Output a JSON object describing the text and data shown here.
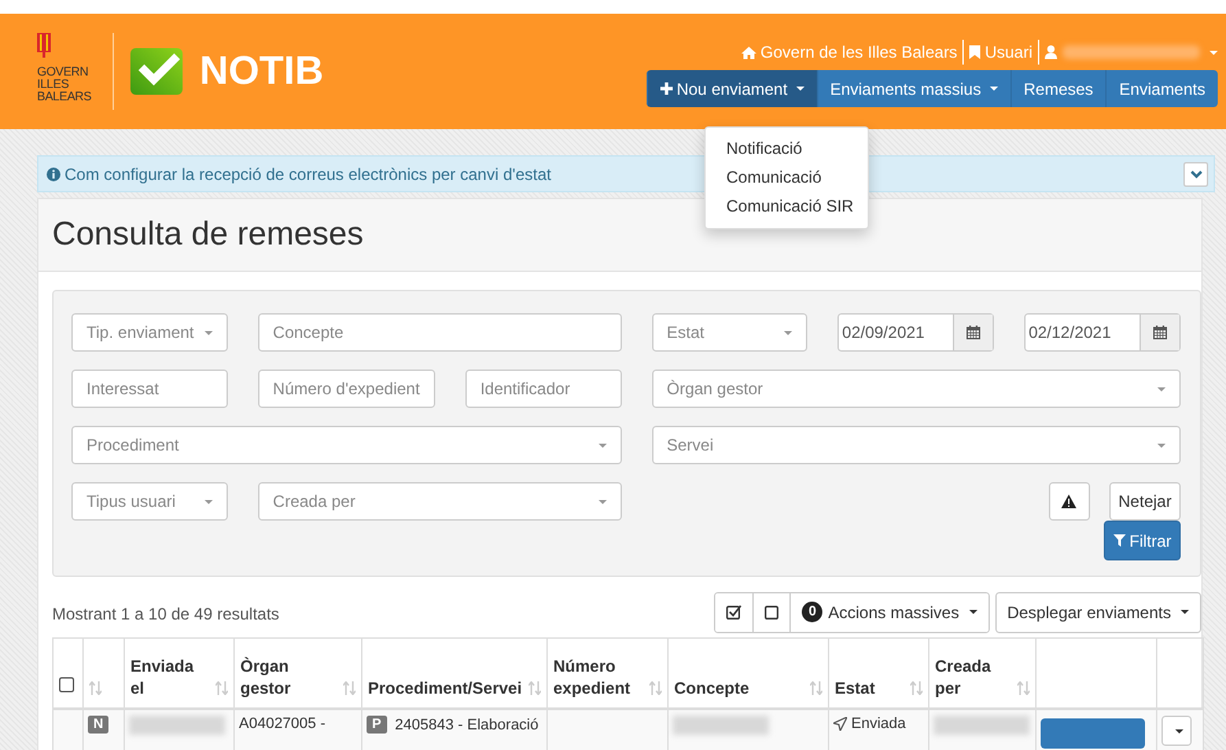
{
  "header": {
    "org_lines": [
      "GOVERN",
      "ILLES",
      "BALEARS"
    ],
    "app_name": "NOTIB",
    "top_links": [
      {
        "kind": "home",
        "label": "Govern de les Illes Balears"
      },
      {
        "kind": "bookmark",
        "label": "Usuari"
      },
      {
        "kind": "user"
      }
    ],
    "nav": [
      {
        "kind": "add-menu",
        "label": "Nou enviament",
        "selected": true
      },
      {
        "kind": "menu",
        "label": "Enviaments massius",
        "selected": false
      },
      {
        "kind": "link",
        "label": "Remeses",
        "selected": false
      },
      {
        "kind": "link",
        "label": "Enviaments",
        "selected": false
      }
    ]
  },
  "dropdown_menu": {
    "items": [
      "Notificació",
      "Comunicació",
      "Comunicació SIR"
    ]
  },
  "info_bar": {
    "text": "Com configurar la recepció de correus electrònics per canvi d'estat"
  },
  "page_title": "Consulta de remeses",
  "filters": [
    {
      "kind": "select",
      "placeholder": "Tip. enviament"
    },
    {
      "kind": "text",
      "placeholder": "Concepte"
    },
    {
      "kind": "select",
      "placeholder": "Estat"
    },
    {
      "kind": "date",
      "value": "02/09/2021"
    },
    {
      "kind": "date",
      "value": "02/12/2021"
    },
    {
      "kind": "text",
      "placeholder": "Interessat"
    },
    {
      "kind": "text",
      "placeholder": "Número d'expedient"
    },
    {
      "kind": "text",
      "placeholder": "Identificador"
    },
    {
      "kind": "select",
      "placeholder": "Òrgan gestor"
    },
    {
      "kind": "select",
      "placeholder": "Procediment"
    },
    {
      "kind": "select",
      "placeholder": "Servei"
    },
    {
      "kind": "select",
      "placeholder": "Tipus usuari"
    },
    {
      "kind": "select",
      "placeholder": "Creada per"
    }
  ],
  "filter_buttons": [
    {
      "kind": "warning"
    },
    {
      "kind": "default",
      "label": "Netejar"
    },
    {
      "kind": "primary",
      "label": "Filtrar"
    }
  ],
  "results_summary": "Mostrant 1 a 10 de 49 resultats",
  "toolbar": {
    "mass_count": "0",
    "mass_label": "Accions massives",
    "expand_label": "Desplegar enviaments"
  },
  "table": {
    "columns": [
      {
        "kind": "checkbox",
        "checked": false
      },
      {
        "kind": "sort"
      },
      {
        "kind": "sort",
        "label": "Enviada el"
      },
      {
        "kind": "sort",
        "label": "Òrgan gestor"
      },
      {
        "kind": "sort",
        "label": "Procediment/Servei"
      },
      {
        "kind": "sort",
        "label": "Número expedient"
      },
      {
        "kind": "sort",
        "label": "Concepte"
      },
      {
        "kind": "sort",
        "label": "Estat"
      },
      {
        "kind": "sort",
        "label": "Creada per"
      },
      {
        "kind": "blank"
      },
      {
        "kind": "blank"
      }
    ],
    "rows": [
      {
        "cells": [
          {
            "kind": "empty"
          },
          {
            "kind": "badge",
            "badge": "N"
          },
          {
            "kind": "blurred"
          },
          {
            "kind": "text",
            "text": "A04027005 -"
          },
          {
            "kind": "badge-text",
            "badge": "P",
            "text": "2405843 - Elaboració"
          },
          {
            "kind": "empty"
          },
          {
            "kind": "blurred"
          },
          {
            "kind": "status",
            "text": "Enviada"
          },
          {
            "kind": "blurred"
          },
          {
            "kind": "action"
          },
          {
            "kind": "caret"
          }
        ]
      }
    ]
  }
}
